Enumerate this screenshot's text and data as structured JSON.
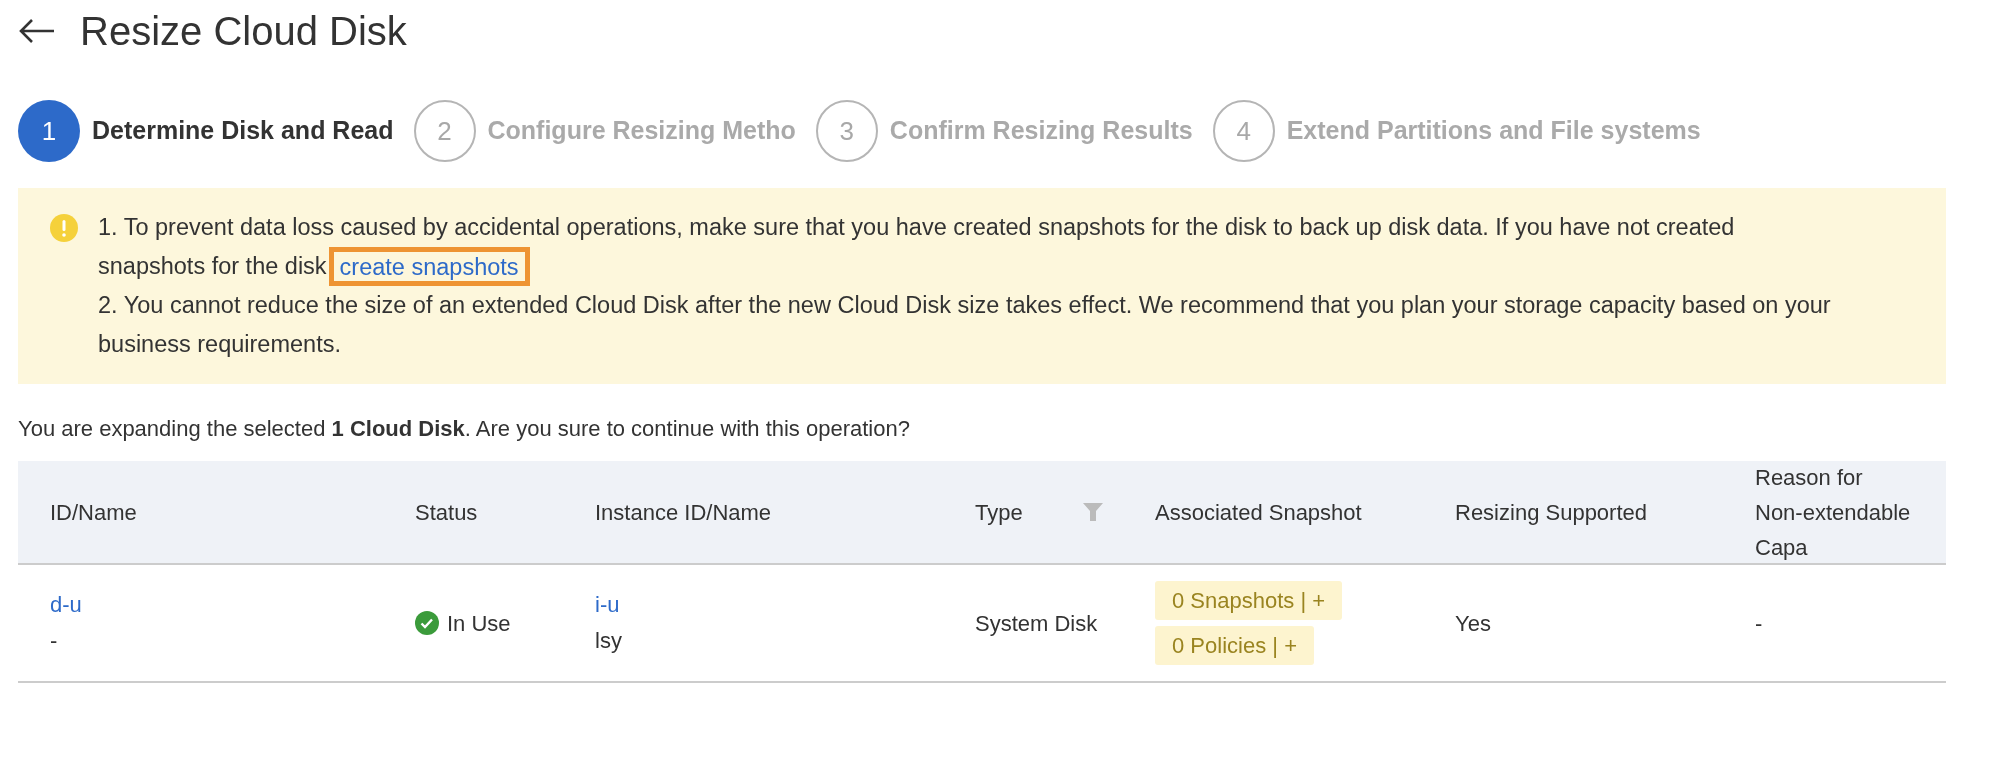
{
  "page": {
    "title": "Resize Cloud Disk"
  },
  "steps": [
    {
      "number": "1",
      "label": "Determine Disk and Read",
      "selected": true
    },
    {
      "number": "2",
      "label": "Configure Resizing Metho",
      "selected": false
    },
    {
      "number": "3",
      "label": "Confirm Resizing Results",
      "selected": false
    },
    {
      "number": "4",
      "label": "Extend Partitions and File systems",
      "selected": false
    }
  ],
  "alert": {
    "item_1_lines": [
      "1. To prevent data loss caused by accidental operations, make sure that you have created snapshots for the disk to back up disk data. If you have not created",
      "snapshots for the disk"
    ],
    "link": "create snapshots",
    "item_2": "2. You cannot reduce the size of an extended Cloud Disk after the new Cloud Disk size takes effect. We recommend that you plan your storage capacity based on your business requirements."
  },
  "confirmation": "You are expanding the selected **1 Cloud Disk**. Are you sure to continue with this operation?",
  "table": {
    "columns": [
      {
        "label": "ID/Name"
      },
      {
        "label": "Status"
      },
      {
        "label": "Instance ID/Name"
      },
      {
        "label": "Type",
        "filterable": true
      },
      {
        "label": "Associated Snapshot"
      },
      {
        "label": "Resizing Supported"
      },
      {
        "label": "Reason for Non-extendable Capa"
      }
    ],
    "rows": [
      {
        "id": "d-u",
        "name": "-",
        "status": {
          "text": "In Use",
          "kind": "ok"
        },
        "instance_id": "i-u",
        "instance_name": "lsy",
        "type": "System Disk",
        "tags": [
          {
            "text": "0 Snapshots",
            "separator": "|",
            "action": "+"
          },
          {
            "text": "0 Policies",
            "separator": "|",
            "action": "+"
          }
        ],
        "resizing": "Yes",
        "reason": "-"
      }
    ]
  }
}
